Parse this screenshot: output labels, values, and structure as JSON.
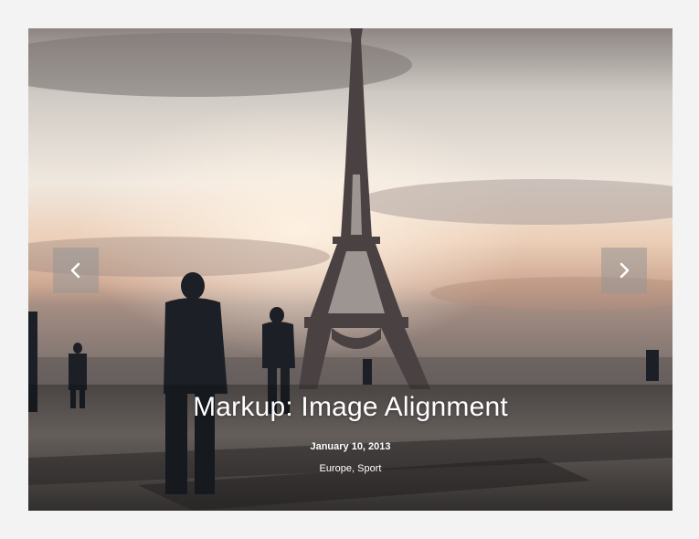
{
  "slider": {
    "prev_icon": "chevron-left-icon",
    "next_icon": "chevron-right-icon"
  },
  "post": {
    "title": "Markup: Image Alignment",
    "date": "January 10, 2013",
    "categories": [
      "Europe",
      "Sport"
    ],
    "category_separator": ", "
  },
  "colors": {
    "page_background": "#f3f3f3",
    "text": "#ffffff",
    "nav_button": "#969696"
  }
}
